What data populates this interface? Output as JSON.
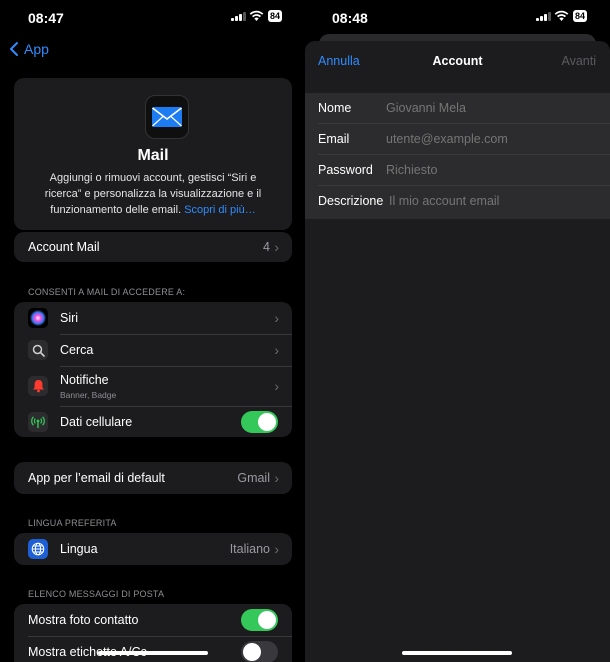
{
  "left": {
    "status": {
      "time": "08:47",
      "battery": "84"
    },
    "nav": {
      "back_label": "App"
    },
    "hero": {
      "title": "Mail",
      "description": "Aggiungi o rimuovi account, gestisci “Siri e ricerca” e personalizza la visualizzazione e il funzionamento delle email.",
      "link": "Scopri di più…"
    },
    "account_row": {
      "label": "Account Mail",
      "value": "4"
    },
    "section_access": "CONSENTI A MAIL DI ACCEDERE A:",
    "access_items": {
      "siri": "Siri",
      "search": "Cerca",
      "notifications": "Notifiche",
      "notifications_sub": "Banner, Badge",
      "cellular": "Dati cellulare"
    },
    "default_app": {
      "label": "App per l’email di default",
      "value": "Gmail"
    },
    "section_language": "LINGUA PREFERITA",
    "language": {
      "label": "Lingua",
      "value": "Italiano"
    },
    "section_messages": "ELENCO MESSAGGI DI POSTA",
    "messages": {
      "show_photo": "Mostra foto contatto",
      "show_labels": "Mostra etichette A/Cc"
    },
    "toggles": {
      "cellular": true,
      "show_photo": true,
      "show_labels": false
    }
  },
  "right": {
    "status": {
      "time": "08:48",
      "battery": "84"
    },
    "header": {
      "cancel": "Annulla",
      "title": "Account",
      "next": "Avanti"
    },
    "form": {
      "name_label": "Nome",
      "name_placeholder": "Giovanni Mela",
      "email_label": "Email",
      "email_placeholder": "utente@example.com",
      "password_label": "Password",
      "password_placeholder": "Richiesto",
      "description_label": "Descrizione",
      "description_placeholder": "Il mio account email"
    }
  },
  "colors": {
    "accent": "#2f8cff",
    "toggle_on": "#34c759",
    "card": "#1c1c1e"
  }
}
